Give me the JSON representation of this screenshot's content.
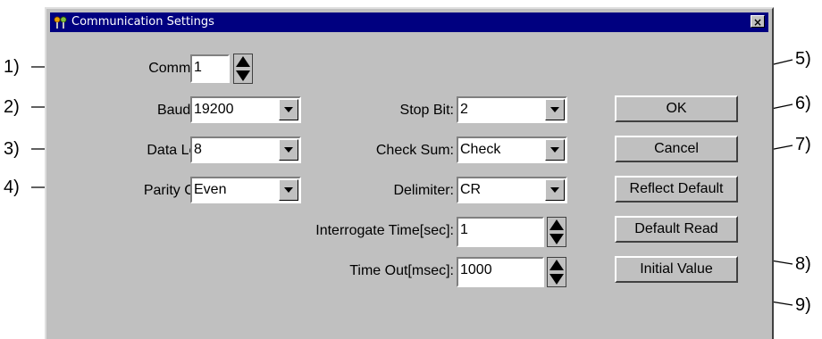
{
  "window": {
    "title": "Communication Settings",
    "close_glyph": "×"
  },
  "fields": {
    "comm_port": {
      "label": "Comm. Port:",
      "value": "1"
    },
    "baud_rate": {
      "label": "Baud Rate:",
      "value": "19200"
    },
    "data_length": {
      "label": "Data Length:",
      "value": "8"
    },
    "parity_check": {
      "label": "Parity Check:",
      "value": "Even"
    },
    "stop_bit": {
      "label": "Stop Bit:",
      "value": "2"
    },
    "check_sum": {
      "label": "Check Sum:",
      "value": "Check"
    },
    "delimiter": {
      "label": "Delimiter:",
      "value": "CR"
    },
    "interrogate_time": {
      "label": "Interrogate Time[sec]:",
      "value": "1"
    },
    "time_out": {
      "label": "Time Out[msec]:",
      "value": "1000"
    }
  },
  "buttons": {
    "ok": "OK",
    "cancel": "Cancel",
    "reflect_default": "Reflect Default",
    "default_read": "Default Read",
    "initial_value": "Initial Value"
  },
  "callouts": [
    "1)",
    "2)",
    "3)",
    "4)",
    "5)",
    "6)",
    "7)",
    "8)",
    "9)"
  ],
  "colors": {
    "face": "#c0c0c0",
    "titlebar": "#000080"
  }
}
